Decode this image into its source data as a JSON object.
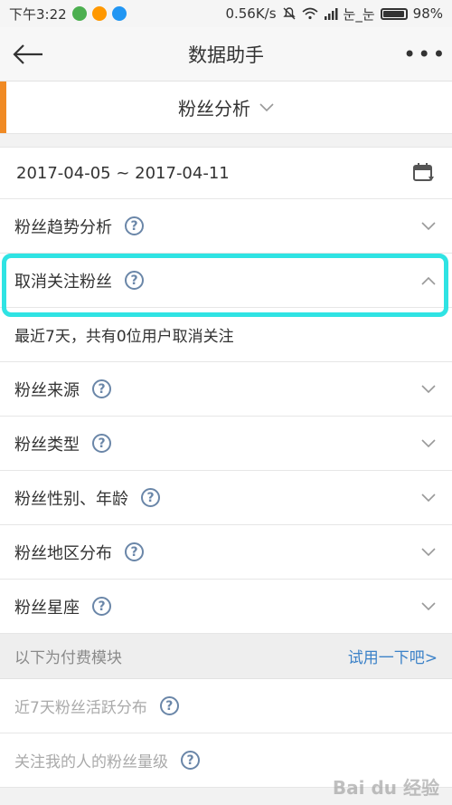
{
  "status_bar": {
    "time": "下午3:22",
    "speed": "0.56K/s",
    "carrier": "눈_눈",
    "battery_text": "98%",
    "battery_level": 0.98
  },
  "top_bar": {
    "title": "数据助手",
    "more": "•••"
  },
  "section": {
    "title": "粉丝分析",
    "accent_color": "#f08a24"
  },
  "date_range": {
    "text": "2017-04-05 ~ 2017-04-11"
  },
  "items": [
    {
      "label": "粉丝趋势分析",
      "help": "?"
    },
    {
      "label": "取消关注粉丝",
      "help": "?"
    },
    {
      "label": "粉丝来源",
      "help": "?"
    },
    {
      "label": "粉丝类型",
      "help": "?"
    },
    {
      "label": "粉丝性别、年龄",
      "help": "?"
    },
    {
      "label": "粉丝地区分布",
      "help": "?"
    },
    {
      "label": "粉丝星座",
      "help": "?"
    }
  ],
  "expanded_detail": "最近7天，共有0位用户取消关注",
  "paid": {
    "title": "以下为付费模块",
    "link": "试用一下吧>",
    "items": [
      {
        "label": "近7天粉丝活跃分布",
        "help": "?"
      },
      {
        "label": "关注我的人的粉丝量级",
        "help": "?"
      }
    ]
  },
  "watermark": "Bai du 经验",
  "colors": {
    "highlight": "#2fe3e3",
    "link": "#3c82c8"
  }
}
